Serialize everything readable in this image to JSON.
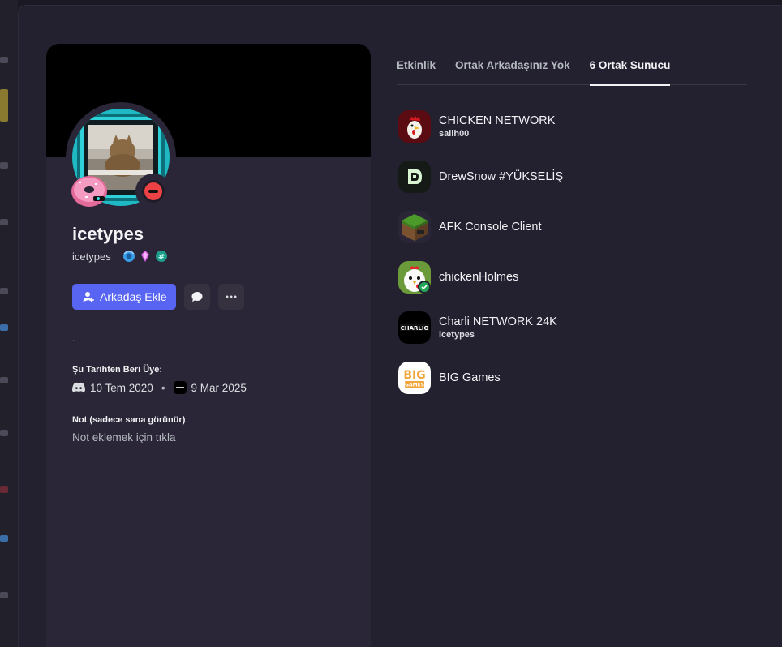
{
  "profile": {
    "display_name": "icetypes",
    "username": "icetypes",
    "add_friend_label": "Arkadaş Ekle",
    "bio": ".",
    "member_since_title": "Şu Tarihten Beri Üye:",
    "discord_date": "10 Tem 2020",
    "server_date": "9 Mar 2025",
    "note_title": "Not (sadece sana görünür)",
    "note_placeholder": "Not eklemek için tıkla"
  },
  "tabs": [
    {
      "label": "Etkinlik",
      "active": false
    },
    {
      "label": "Ortak Arkadaşınız Yok",
      "active": false
    },
    {
      "label": "6 Ortak Sunucu",
      "active": true
    }
  ],
  "servers": [
    {
      "name": "CHICKEN NETWORK",
      "nickname": "salih00",
      "icon": "rooster-icon"
    },
    {
      "name": "DrewSnow #YÜKSELİŞ",
      "nickname": "",
      "icon": "drewsnow-d-icon"
    },
    {
      "name": "AFK Console Client",
      "nickname": "",
      "icon": "grass-block-icon"
    },
    {
      "name": "chickenHolmes",
      "nickname": "",
      "icon": "cartoon-chicken-icon"
    },
    {
      "name": "Charli NETWORK 24K",
      "nickname": "icetypes",
      "icon": "charlio-logo-icon"
    },
    {
      "name": "BIG Games",
      "nickname": "",
      "icon": "big-games-logo-icon"
    }
  ],
  "colors": {
    "accent": "#5865f2",
    "dnd": "#ed4245",
    "background": "#232030",
    "card": "#2a2637"
  }
}
